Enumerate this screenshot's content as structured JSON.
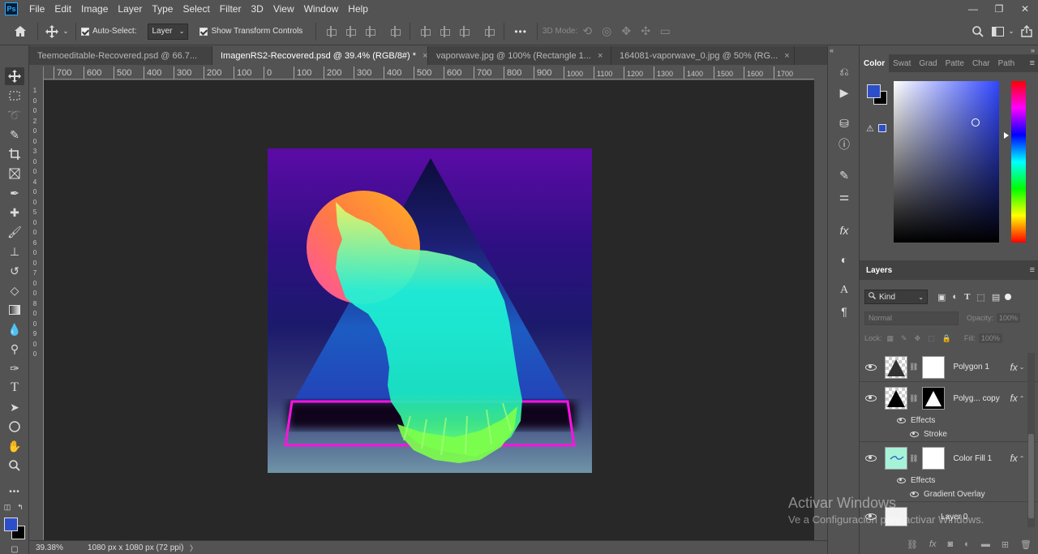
{
  "app": {
    "logo": "Ps"
  },
  "menu": [
    "File",
    "Edit",
    "Image",
    "Layer",
    "Type",
    "Select",
    "Filter",
    "3D",
    "View",
    "Window",
    "Help"
  ],
  "window_controls": {
    "minimize": "—",
    "restore": "❐",
    "close": "✕"
  },
  "options": {
    "auto_select_label": "Auto-Select:",
    "auto_select_target": "Layer",
    "show_transform_label": "Show Transform Controls",
    "more": "•••",
    "mode_label": "3D Mode:"
  },
  "tabs": [
    {
      "label": "Teemoeditable-Recovered.psd @ 66.7...",
      "active": false
    },
    {
      "label": "ImagenRS2-Recovered.psd @ 39.4% (RGB/8#) *",
      "active": true
    },
    {
      "label": "vaporwave.jpg @ 100% (Rectangle 1...",
      "active": false
    },
    {
      "label": "164081-vaporwave_0.jpg @ 50% (RG...",
      "active": false
    }
  ],
  "tab_close": "×",
  "ruler_h": {
    "large": [
      "700",
      "600",
      "500",
      "400",
      "300",
      "200",
      "100",
      "0",
      "100",
      "200",
      "300",
      "400",
      "500",
      "600",
      "700",
      "800",
      "900"
    ],
    "small": [
      "1000",
      "1100",
      "1200",
      "1300",
      "1400",
      "1500",
      "1600",
      "1700"
    ]
  },
  "ruler_v": [
    "1",
    "0",
    "0",
    "2",
    "0",
    "0",
    "3",
    "0",
    "0",
    "4",
    "0",
    "0",
    "5",
    "0",
    "0",
    "6",
    "0",
    "0",
    "7",
    "0",
    "0",
    "8",
    "0",
    "0",
    "9",
    "0",
    "0"
  ],
  "status": {
    "zoom": "39.38%",
    "doc_size": "1080 px x 1080 px (72 ppi)",
    "arrow": "〉"
  },
  "color_panel": {
    "tabs": [
      "Color",
      "Swat",
      "Grad",
      "Patte",
      "Char",
      "Path"
    ],
    "foreground": "#2c4fc9",
    "background": "#000000"
  },
  "layers_panel": {
    "title": "Layers",
    "kind_label": "Kind",
    "blend_mode": "Normal",
    "opacity_label": "Opacity:",
    "opacity_value": "100%",
    "lock_label": "Lock:",
    "fill_label": "Fill:",
    "fill_value": "100%",
    "layers": [
      {
        "name": "Polygon 1",
        "fx": "fx"
      },
      {
        "name": "Polyg... copy",
        "fx": "fx"
      },
      {
        "name": "Color Fill 1",
        "fx": "fx"
      },
      {
        "name": "Layer 0"
      }
    ],
    "effects_label": "Effects",
    "effect_stroke": "Stroke",
    "effect_gradient": "Gradient Overlay"
  },
  "watermark": {
    "line1": "Activar Windows",
    "line2": "Ve a Configuración para activar Windows."
  }
}
